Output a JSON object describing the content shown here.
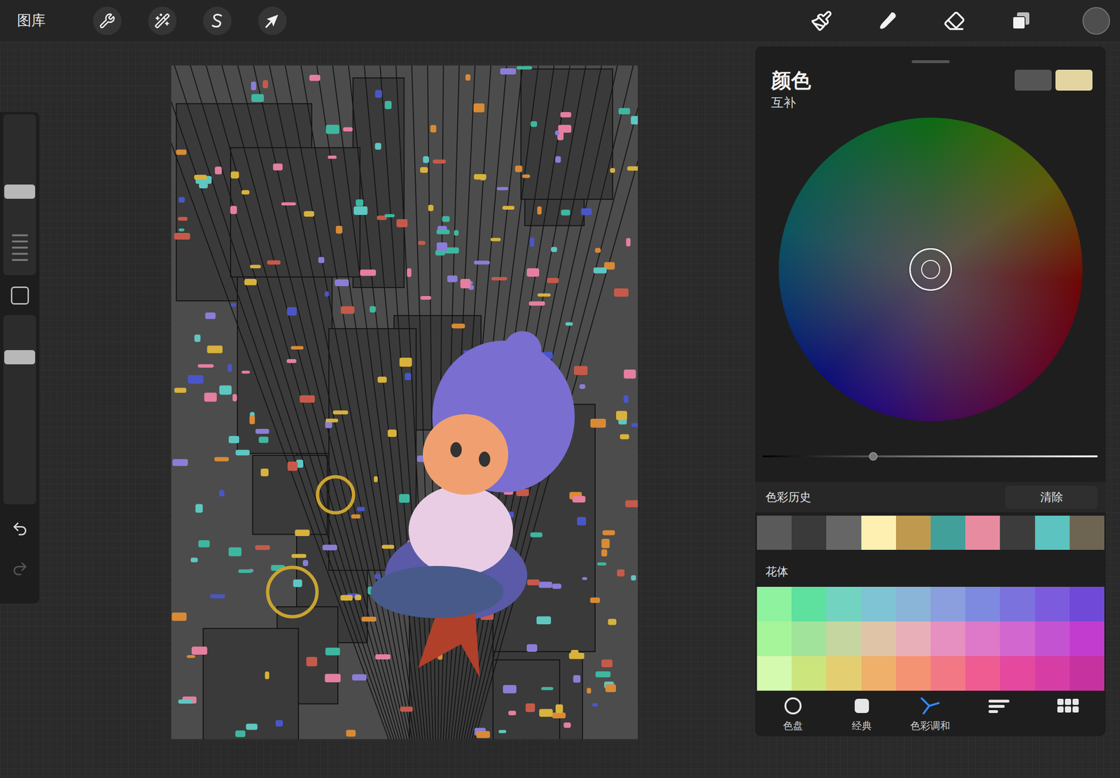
{
  "toolbar": {
    "gallery": "图库",
    "current_color": "#4e4e4e"
  },
  "sidebar": {
    "sliders": [
      {
        "name": "brush-size",
        "level": 0.52
      },
      {
        "name": "opacity",
        "level": 0.8
      }
    ],
    "undo": {
      "disabled": false
    },
    "redo": {
      "disabled": true
    }
  },
  "color_panel": {
    "title": "颜色",
    "mode": "互补",
    "primary": "#555555",
    "secondary": "#e2d5a2",
    "brightness": {
      "level": 0.33
    },
    "history": {
      "title": "色彩历史",
      "clear": "清除",
      "swatches": [
        {
          "color": "#5a5a5a"
        },
        {
          "color": "#3a3a3a"
        },
        {
          "color": "#666666"
        },
        {
          "color": "#fdf0b0"
        },
        {
          "color": "#bf9a4e"
        },
        {
          "color": "#41a09a"
        },
        {
          "color": "#e78ba0"
        },
        {
          "color": "#3c3c3c"
        },
        {
          "color": "#5cc3c0"
        },
        {
          "color": "#6e6452"
        }
      ]
    },
    "palette": {
      "title": "花体",
      "rows": [
        [
          "#8ff29e",
          "#5ee09e",
          "#72d4c0",
          "#7ec4d4",
          "#8ab4d8",
          "#8b9ede",
          "#7d8ae0",
          "#7c72de",
          "#7d5bdd",
          "#7049d9"
        ],
        [
          "#a6f59a",
          "#a1e39a",
          "#c6d6a0",
          "#e0c4a8",
          "#e8afb8",
          "#e590c0",
          "#de78c8",
          "#d267d0",
          "#c453d2",
          "#c23dcf"
        ],
        [
          "#d4fab0",
          "#cde57d",
          "#e3cf72",
          "#efb06c",
          "#f49274",
          "#f27886",
          "#ee5c92",
          "#e4499f",
          "#d63ea6",
          "#c632a0"
        ]
      ]
    },
    "tabs": [
      {
        "label": "色盘",
        "selected": false
      },
      {
        "label": "经典",
        "selected": false
      },
      {
        "label": "色彩调和",
        "selected": true
      },
      {
        "label": "",
        "selected": false
      },
      {
        "label": "",
        "selected": false
      }
    ]
  }
}
